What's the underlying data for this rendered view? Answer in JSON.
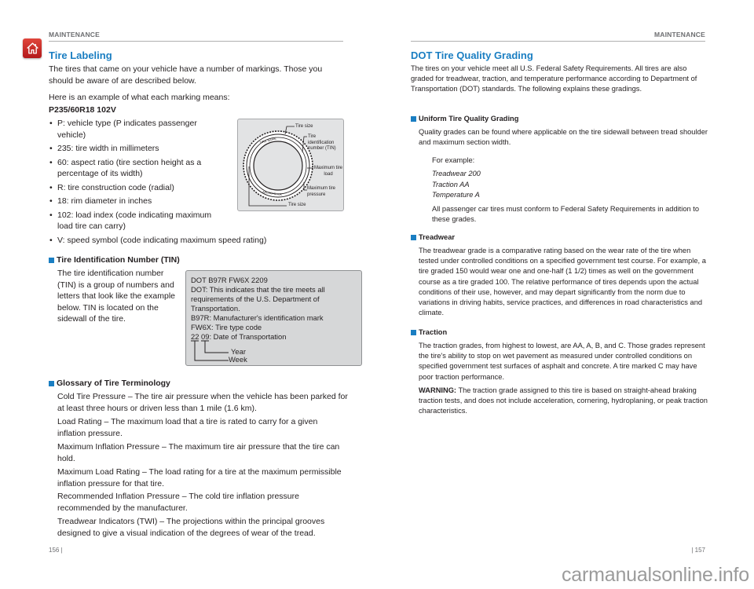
{
  "left_page": {
    "section_header": "MAINTENANCE",
    "home_icon": "home-icon",
    "title": "Tire Labeling",
    "intro": "The tires that came on your vehicle have a number of markings. Those you should be aware of are described below.",
    "example_lead": "Here is an example of what each marking means:",
    "example_code": "P235/60R18 102V",
    "bullets": [
      "P: vehicle type (P indicates passenger vehicle)",
      "235: tire width in millimeters",
      "60: aspect ratio (tire section height as a percentage of its width)",
      "R: tire construction code (radial)",
      "18: rim diameter in inches",
      "102: load index (code indicating maximum load tire can carry)",
      "V: speed symbol (code indicating maximum speed rating)"
    ],
    "tire_figure": {
      "labels": {
        "tire_size_top": "Tire size",
        "tin": "Tire identification number (TIN)",
        "max_load": "Maximum tire load",
        "max_pressure": "Maximum tire pressure",
        "tire_size_bottom": "Tire size"
      }
    },
    "tin_section": {
      "heading": "Tire Identification Number (TIN)",
      "body": "The tire identification number (TIN) is a group of numbers and letters that look like the example below. TIN is located on the sidewall of the tire."
    },
    "tin_figure": {
      "lines": [
        "DOT B97R FW6X 2209",
        "DOT: This indicates that the tire meets all",
        "requirements of the U.S. Department of",
        "Transportation.",
        "B97R: Manufacturer's identification mark",
        "FW6X: Tire type code",
        "22 09: Date of Transportation"
      ],
      "year_label": "Year",
      "week_label": "Week"
    },
    "glossary": {
      "heading": "Glossary of Tire Terminology",
      "entries": [
        "Cold Tire Pressure – The tire air pressure when the vehicle has been parked for at least three hours or driven less than 1 mile (1.6 km).",
        "Load Rating – The maximum load that a tire is rated to carry for a given inflation pressure.",
        "Maximum Inflation Pressure – The maximum tire air pressure that the tire can hold.",
        "Maximum Load Rating – The load rating for a tire at the maximum permissible inflation pressure for that tire.",
        "Recommended Inflation Pressure – The cold tire inflation pressure recommended by the manufacturer.",
        "Treadwear Indicators (TWI) – The projections within the principal grooves designed to give a visual indication of the degrees of wear of the tread."
      ]
    },
    "page_number": "156  |"
  },
  "right_page": {
    "section_header": "MAINTENANCE",
    "title": "DOT Tire Quality Grading",
    "intro": "The tires on your vehicle meet all U.S. Federal Safety Requirements. All tires are also graded for treadwear, traction, and temperature performance according to Department of Transportation (DOT) standards. The following explains these gradings.",
    "utqg": {
      "heading": "Uniform Tire Quality Grading",
      "body": "Quality grades can be found where applicable on the tire sidewall between tread shoulder and maximum section width.",
      "example_lead": "For example:",
      "examples": [
        "Treadwear 200",
        "Traction AA",
        "Temperature A"
      ],
      "note": "All passenger car tires must conform to Federal Safety Requirements in addition to these grades."
    },
    "treadwear": {
      "heading": "Treadwear",
      "body": "The treadwear grade is a comparative rating based on the wear rate of the tire when tested under controlled conditions on a specified government test course. For example, a tire graded 150 would wear one and one-half (1 1/2) times as well on the government course as a tire graded 100. The relative performance of tires depends upon the actual conditions of their use, however, and may depart significantly from the norm due to variations in driving habits, service practices, and differences in road characteristics and climate."
    },
    "traction": {
      "heading": "Traction",
      "body": "The traction grades, from highest to lowest, are AA, A, B, and C. Those grades represent the tire's ability to stop on wet pavement as measured under controlled conditions on specified government test surfaces of asphalt and concrete. A tire marked C may have poor traction performance.",
      "warning_label": "WARNING:",
      "warning_body": " The traction grade assigned to this tire is based on straight-ahead braking traction tests, and does not include acceleration, cornering, hydroplaning, or peak traction characteristics."
    },
    "page_number": "|  157"
  },
  "watermark": "carmanualsonline.info",
  "colors": {
    "accent_blue": "#1a7ec2",
    "home_red": "#c8262b",
    "header_gray": "#6d6e71"
  }
}
